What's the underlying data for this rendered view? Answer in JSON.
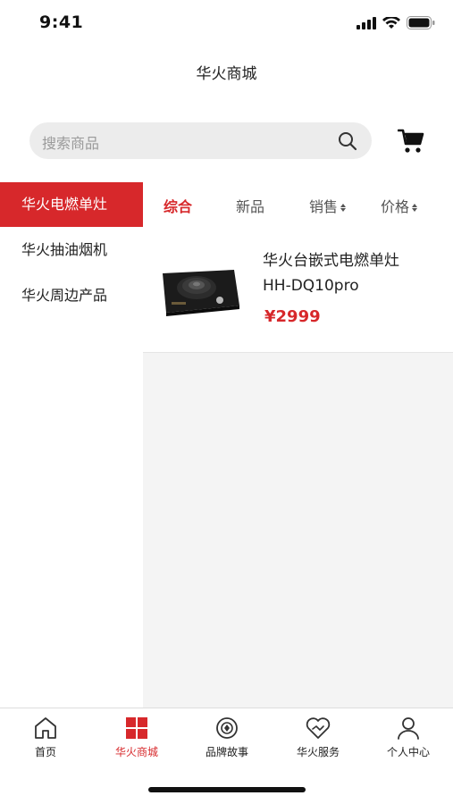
{
  "status_bar": {
    "time": "9:41"
  },
  "header": {
    "title": "华火商城"
  },
  "search": {
    "placeholder": "搜索商品"
  },
  "sidebar": {
    "items": [
      {
        "label": "华火电燃单灶",
        "active": true
      },
      {
        "label": "华火抽油烟机",
        "active": false
      },
      {
        "label": "华火周边产品",
        "active": false
      }
    ]
  },
  "sort_tabs": [
    {
      "label": "综合",
      "active": true
    },
    {
      "label": "新品",
      "active": false
    },
    {
      "label": "销售",
      "active": false
    },
    {
      "label": "价格",
      "active": false
    }
  ],
  "products": [
    {
      "name_line1": "华火台嵌式电燃单灶",
      "name_line2": "HH-DQ10pro",
      "price": "¥2999"
    }
  ],
  "tab_bar": {
    "items": [
      {
        "label": "首页",
        "icon": "home-icon",
        "active": false
      },
      {
        "label": "华火商城",
        "icon": "grid-icon",
        "active": true
      },
      {
        "label": "品牌故事",
        "icon": "brand-icon",
        "active": false
      },
      {
        "label": "华火服务",
        "icon": "service-icon",
        "active": false
      },
      {
        "label": "个人中心",
        "icon": "user-icon",
        "active": false
      }
    ]
  },
  "colors": {
    "accent": "#d7282b",
    "background_gray": "#f4f4f4",
    "search_bg": "#ececec"
  }
}
